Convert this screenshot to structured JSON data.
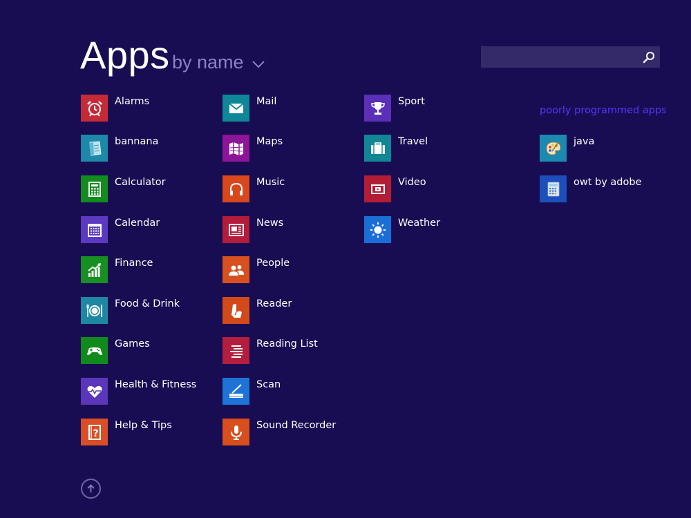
{
  "header": {
    "title": "Apps",
    "sort_label": "by name"
  },
  "search": {
    "value": "",
    "placeholder": ""
  },
  "columns": [
    [
      {
        "name": "Alarms",
        "icon": "alarm-clock-icon",
        "color": "#c72a37"
      },
      {
        "name": "bannana",
        "icon": "notepad-icon",
        "color": "#1d88a7"
      },
      {
        "name": "Calculator",
        "icon": "calculator-icon",
        "color": "#118c1d"
      },
      {
        "name": "Calendar",
        "icon": "calendar-icon",
        "color": "#5c3abf"
      },
      {
        "name": "Finance",
        "icon": "finance-chart-icon",
        "color": "#188f22"
      },
      {
        "name": "Food & Drink",
        "icon": "plate-cutlery-icon",
        "color": "#1e88a3"
      },
      {
        "name": "Games",
        "icon": "game-controller-icon",
        "color": "#118a1c"
      },
      {
        "name": "Health & Fitness",
        "icon": "heart-pulse-icon",
        "color": "#5a36b8"
      },
      {
        "name": "Help & Tips",
        "icon": "help-question-icon",
        "color": "#d84e26"
      }
    ],
    [
      {
        "name": "Mail",
        "icon": "envelope-icon",
        "color": "#0f8799"
      },
      {
        "name": "Maps",
        "icon": "map-icon",
        "color": "#8d1597"
      },
      {
        "name": "Music",
        "icon": "headphones-icon",
        "color": "#d8481c"
      },
      {
        "name": "News",
        "icon": "newspaper-icon",
        "color": "#b31c3b"
      },
      {
        "name": "People",
        "icon": "people-icon",
        "color": "#d8501d"
      },
      {
        "name": "Reader",
        "icon": "reader-icon",
        "color": "#d24a1c"
      },
      {
        "name": "Reading List",
        "icon": "reading-list-icon",
        "color": "#b31d3e"
      },
      {
        "name": "Scan",
        "icon": "scanner-icon",
        "color": "#1d73d6"
      },
      {
        "name": "Sound Recorder",
        "icon": "microphone-icon",
        "color": "#d84e1d"
      }
    ],
    [
      {
        "name": "Sport",
        "icon": "trophy-icon",
        "color": "#5b30b8"
      },
      {
        "name": "Travel",
        "icon": "suitcase-icon",
        "color": "#118695"
      },
      {
        "name": "Video",
        "icon": "video-icon",
        "color": "#b31c35"
      },
      {
        "name": "Weather",
        "icon": "sun-icon",
        "color": "#1b6ed6"
      }
    ]
  ],
  "other_group": {
    "title": "poorly programmed apps",
    "apps": [
      {
        "name": "java",
        "icon": "paint-palette-icon",
        "color": "#1c8ab0"
      },
      {
        "name": "owt by adobe",
        "icon": "calculator-app-icon",
        "color": "#1c4fbb"
      }
    ]
  }
}
